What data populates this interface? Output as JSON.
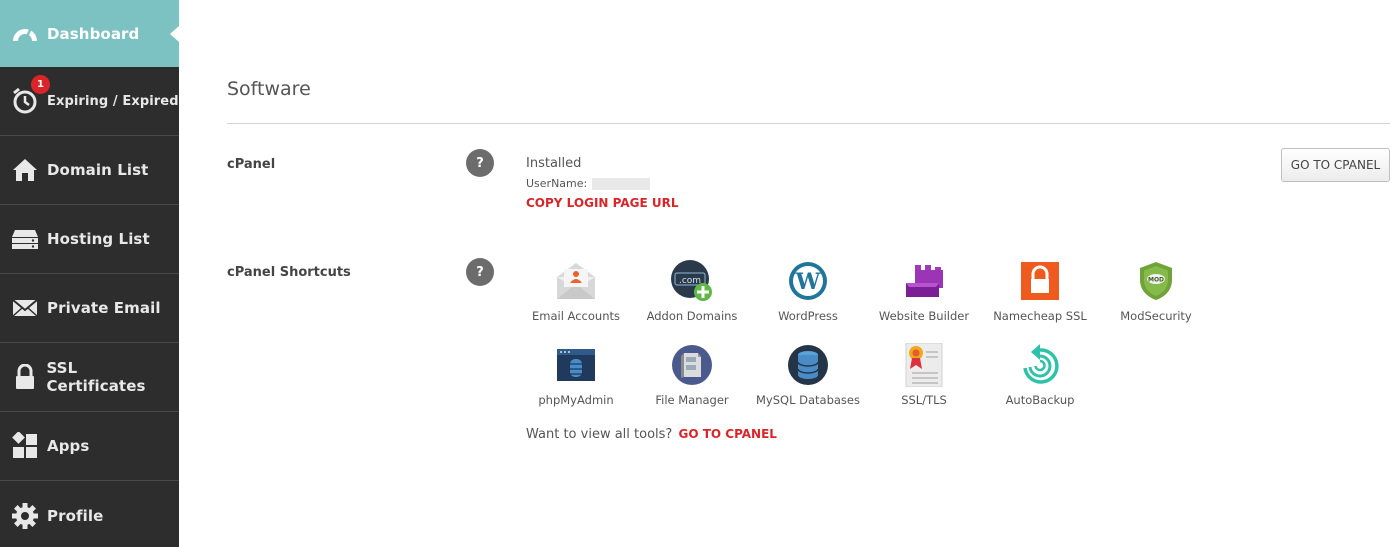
{
  "sidebar": {
    "items": [
      {
        "label": "Dashboard",
        "icon": "gauge-icon",
        "active": true
      },
      {
        "label": "Expiring / Expired",
        "icon": "alarm-clock-icon",
        "badge": "1"
      },
      {
        "label": "Domain List",
        "icon": "home-icon"
      },
      {
        "label": "Hosting List",
        "icon": "server-icon"
      },
      {
        "label": "Private Email",
        "icon": "envelope-icon"
      },
      {
        "label": "SSL Certificates",
        "icon": "lock-icon"
      },
      {
        "label": "Apps",
        "icon": "apps-icon"
      },
      {
        "label": "Profile",
        "icon": "gear-icon"
      }
    ]
  },
  "main": {
    "section_title": "Software",
    "cpanel": {
      "label": "cPanel",
      "help": "?",
      "status": "Installed",
      "username_label": "UserName:",
      "copy_link": "COPY LOGIN PAGE URL",
      "button": "GO TO CPANEL"
    },
    "shortcuts": {
      "label": "cPanel Shortcuts",
      "help": "?",
      "items": [
        {
          "label": "Email Accounts",
          "icon": "email-accounts-icon"
        },
        {
          "label": "Addon Domains",
          "icon": "addon-domains-icon"
        },
        {
          "label": "WordPress",
          "icon": "wordpress-icon"
        },
        {
          "label": "Website Builder",
          "icon": "website-builder-icon"
        },
        {
          "label": "Namecheap SSL",
          "icon": "namecheap-ssl-icon"
        },
        {
          "label": "ModSecurity",
          "icon": "modsecurity-icon"
        },
        {
          "label": "phpMyAdmin",
          "icon": "phpmyadmin-icon"
        },
        {
          "label": "File Manager",
          "icon": "file-manager-icon"
        },
        {
          "label": "MySQL Databases",
          "icon": "mysql-databases-icon"
        },
        {
          "label": "SSL/TLS",
          "icon": "ssl-tls-icon"
        },
        {
          "label": "AutoBackup",
          "icon": "autobackup-icon"
        }
      ],
      "footer_text": "Want to view all tools?",
      "footer_link": "GO TO CPANEL"
    }
  },
  "colors": {
    "sidebar_bg": "#2d2d2d",
    "active_bg": "#7dc2c2",
    "accent_red": "#d9252a"
  }
}
